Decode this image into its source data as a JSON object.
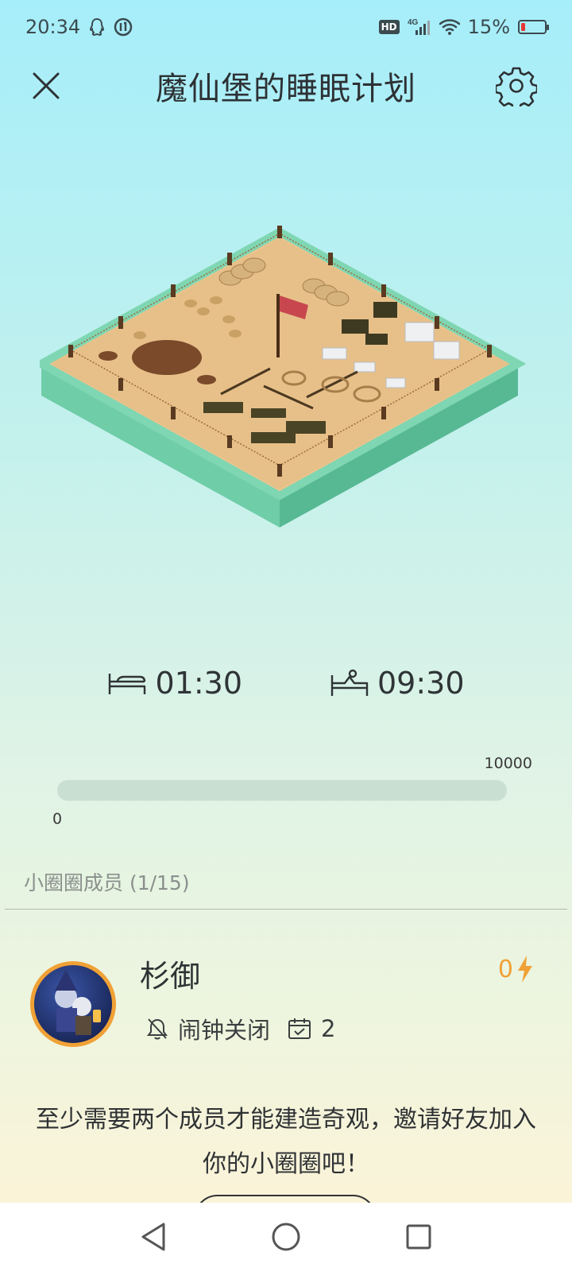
{
  "status_bar": {
    "time": "20:34",
    "left_icons": [
      "qq-icon",
      "notification-badge-icon"
    ],
    "hd_label": "HD",
    "network_label": "4G",
    "battery_percent": "15%",
    "battery_level": 0.15
  },
  "header": {
    "title": "魔仙堡的睡眠计划",
    "close_icon": "close-icon",
    "settings_icon": "gear-icon"
  },
  "sleep": {
    "bedtime": "01:30",
    "wake_time": "09:30",
    "bedtime_icon": "bed-icon",
    "wake_icon": "wake-up-icon"
  },
  "progress": {
    "min_label": "0",
    "max_label": "10000",
    "value": 0
  },
  "members": {
    "header": "小圈圈成员 (1/15)",
    "list": [
      {
        "name": "杉御",
        "alarm_status": "闹钟关闭",
        "checkin_count": "2",
        "energy": "0"
      }
    ]
  },
  "invite": {
    "message": "至少需要两个成员才能建造奇观，邀请好友加入你的小圈圈吧！"
  },
  "colors": {
    "accent": "#f0a136",
    "title_text": "#2d3134",
    "progress_track": "#c9dfd2"
  }
}
